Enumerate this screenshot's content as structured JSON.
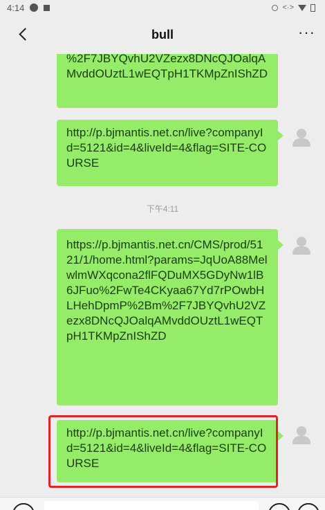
{
  "status_bar": {
    "time": "4:14",
    "net_label": "<·>"
  },
  "header": {
    "title": "bull",
    "more_label": "···"
  },
  "messages": [
    {
      "text": "%2F7JBYQvhU2VZezx8DNcQJOalqAMvddOUztL1wEQTpH1TKMpZnIShZD"
    },
    {
      "text": "http://p.bjmantis.net.cn/live?companyId=5121&id=4&liveId=4&flag=SITE-COURSE"
    },
    {
      "text": "https://p.bjmantis.net.cn/CMS/prod/5121/1/home.html?params=JqUoA88MelwlmWXqcona2flFQDuMX5GDyNw1lB6JFuo%2FwTe4CKyaa67Yd7rPOwbHLHehDpmP%2Bm%2F7JBYQvhU2VZezx8DNcQJOalqAMvddOUztL1wEQTpH1TKMpZnIShZD"
    },
    {
      "text": "http://p.bjmantis.net.cn/live?companyId=5121&id=4&liveId=4&flag=SITE-COURSE"
    }
  ],
  "timestamp": "下午4:11",
  "colors": {
    "bubble": "#95ec69",
    "highlight": "#e2232a",
    "background": "#ededed"
  },
  "icons": [
    "back-arrow-icon",
    "more-icon",
    "avatar-icon",
    "voice-icon",
    "emoji-icon",
    "plus-icon"
  ]
}
